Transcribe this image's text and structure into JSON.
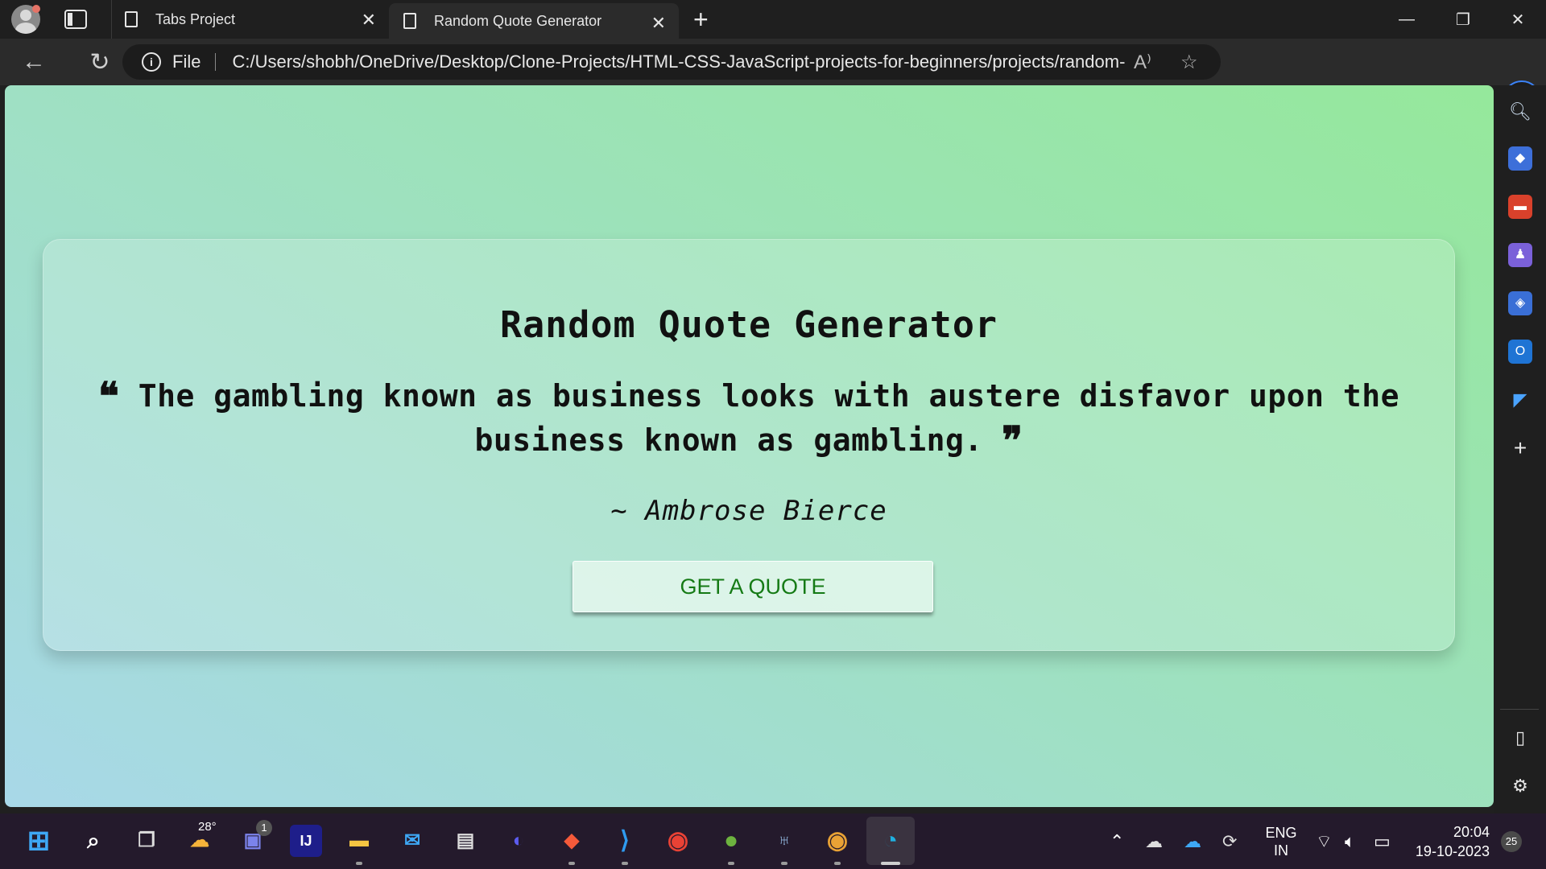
{
  "browser": {
    "tabs": [
      {
        "title": "Tabs Project",
        "active": false
      },
      {
        "title": "Random Quote Generator",
        "active": true
      }
    ],
    "address": {
      "scheme_label": "File",
      "url": "C:/Users/shobh/OneDrive/Desktop/Clone-Projects/HTML-CSS-JavaScript-projects-for-beginners/projects/random-qu..."
    }
  },
  "page": {
    "heading": "Random Quote Generator",
    "quote_text": "The gambling known as business looks with austere disfavor upon the business known as gambling.",
    "author": "~ Ambrose Bierce",
    "button_label": "GET A QUOTE",
    "open_quote_glyph": "❝",
    "close_quote_glyph": "❞"
  },
  "taskbar": {
    "weather_temp": "28°",
    "teams_badge": "1",
    "language": "ENG",
    "region": "IN",
    "time": "20:04",
    "date": "19-10-2023",
    "notification_count": "25"
  }
}
